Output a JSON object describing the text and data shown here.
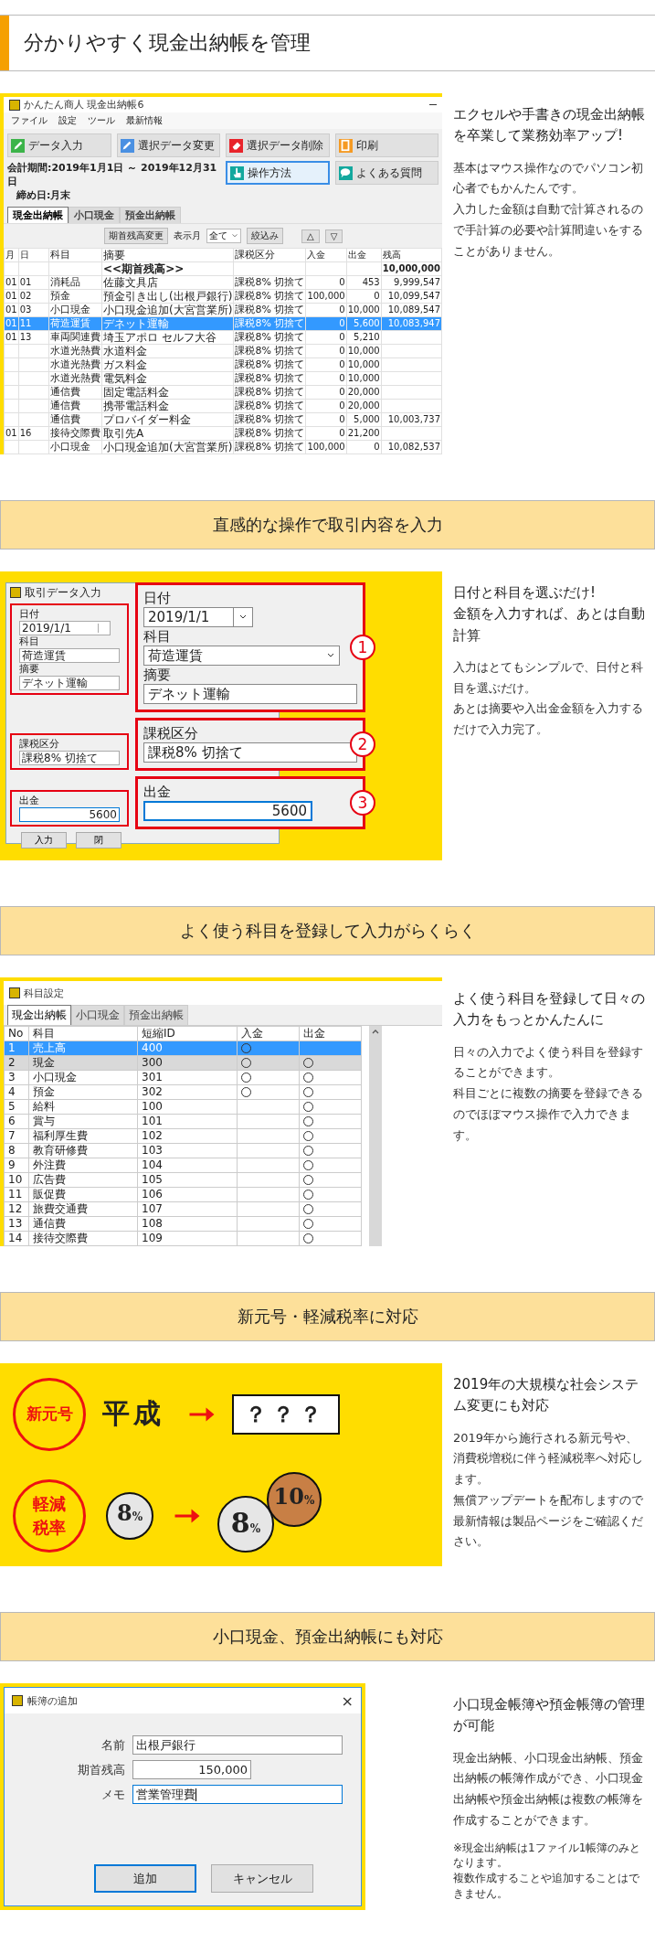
{
  "sections": [
    {
      "heading": "分かりやすく現金出納帳を管理",
      "lead": [
        "エクセルや手書きの現金出納帳を卒業して業務効率アップ!"
      ],
      "body": [
        "基本はマウス操作なのでパソコン初心者でもかんたんです。",
        "入力した金額は自動で計算されるので手計算の必要や計算間違いをすることがありません。"
      ],
      "visual": {
        "kind": "ledger",
        "window_title": "かんたん商人 現金出納帳6",
        "menu": [
          "ファイル",
          "設定",
          "ツール",
          "最新情報"
        ],
        "buttons": [
          {
            "label": "データ入力",
            "color": "#3cb44a",
            "focused": false
          },
          {
            "label": "選択データ変更",
            "color": "#4a90e2",
            "focused": false
          },
          {
            "label": "選択データ削除",
            "color": "#e8242b",
            "focused": false
          },
          {
            "label": "印刷",
            "color": "#f59a23",
            "focused": false
          },
          {
            "label": "操作方法",
            "color": "#13a89e",
            "focused": true
          },
          {
            "label": "よくある質問",
            "color": "#13a89e",
            "focused": false
          }
        ],
        "period": "会計期間:2019年1月1日 ～ 2019年12月31日",
        "closing": "締め日:月末",
        "tabs": [
          {
            "label": "現金出納帳",
            "selected": true
          },
          {
            "label": "小口現金",
            "selected": false
          },
          {
            "label": "預金出納帳",
            "selected": false
          }
        ],
        "toolbar": {
          "reset_button": "期首残高変更",
          "month_label": "表示月",
          "month_value": "全て",
          "filter_button": "絞込み",
          "up": "△",
          "down": "▽"
        },
        "columns": [
          "月",
          "日",
          "科目",
          "摘要",
          "課税区分",
          "入金",
          "出金",
          "残高"
        ],
        "rows": [
          {
            "kind": "opening",
            "selected": false,
            "cells": [
              null,
              null,
              null,
              "<<期首残高>>",
              null,
              null,
              null,
              "10,000,000"
            ]
          },
          {
            "kind": "entry",
            "selected": false,
            "cells": [
              "01",
              "01",
              "消耗品",
              "佐藤文具店",
              "課税8% 切捨て",
              "0",
              "453",
              "9,999,547"
            ]
          },
          {
            "kind": "entry",
            "selected": false,
            "cells": [
              "01",
              "02",
              "預金",
              "預金引き出し(出根戸銀行)",
              "課税8% 切捨て",
              "100,000",
              "0",
              "10,099,547"
            ]
          },
          {
            "kind": "entry",
            "selected": false,
            "cells": [
              "01",
              "03",
              "小口現金",
              "小口現金追加(大宮営業所)",
              "課税8% 切捨て",
              "0",
              "10,000",
              "10,089,547"
            ]
          },
          {
            "kind": "entry",
            "selected": true,
            "cells": [
              "01",
              "11",
              "荷造運賃",
              "デネット運輸",
              "課税8% 切捨て",
              "0",
              "5,600",
              "10,083,947"
            ]
          },
          {
            "kind": "entry",
            "selected": false,
            "cells": [
              "01",
              "13",
              "車両関連費",
              "埼玉アポロ セルフ大谷",
              "課税8% 切捨て",
              "0",
              "5,210",
              null
            ]
          },
          {
            "kind": "entry",
            "selected": false,
            "cells": [
              null,
              null,
              "水道光熱費",
              "水道料金",
              "課税8% 切捨て",
              "0",
              "10,000",
              null
            ]
          },
          {
            "kind": "entry",
            "selected": false,
            "cells": [
              null,
              null,
              "水道光熱費",
              "ガス料金",
              "課税8% 切捨て",
              "0",
              "10,000",
              null
            ]
          },
          {
            "kind": "entry",
            "selected": false,
            "cells": [
              null,
              null,
              "水道光熱費",
              "電気料金",
              "課税8% 切捨て",
              "0",
              "10,000",
              null
            ]
          },
          {
            "kind": "entry",
            "selected": false,
            "cells": [
              null,
              null,
              "通信費",
              "固定電話料金",
              "課税8% 切捨て",
              "0",
              "20,000",
              null
            ]
          },
          {
            "kind": "entry",
            "selected": false,
            "cells": [
              null,
              null,
              "通信費",
              "携帯電話料金",
              "課税8% 切捨て",
              "0",
              "20,000",
              null
            ]
          },
          {
            "kind": "entry",
            "selected": false,
            "cells": [
              null,
              null,
              "通信費",
              "プロバイダー料金",
              "課税8% 切捨て",
              "0",
              "5,000",
              "10,003,737"
            ]
          },
          {
            "kind": "entry",
            "selected": false,
            "cells": [
              "01",
              "16",
              "接待交際費",
              "取引先A",
              "課税8% 切捨て",
              "0",
              "21,200",
              null
            ]
          },
          {
            "kind": "entry",
            "selected": false,
            "cells": [
              null,
              null,
              "小口現金",
              "小口現金追加(大宮営業所)",
              "課税8% 切捨て",
              "100,000",
              "0",
              "10,082,537"
            ]
          }
        ]
      }
    },
    {
      "heading": "直感的な操作で取引内容を入力",
      "lead": [
        "日付と科目を選ぶだけ!",
        "金額を入力すれば、あとは自動計算"
      ],
      "body": [
        "入力はとてもシンプルで、日付と科目を選ぶだけ。",
        "あとは摘要や入出金金額を入力するだけで入力完了。"
      ],
      "visual": {
        "kind": "entry_form",
        "dialog_title": "取引データ入力",
        "form_groups": [
          {
            "fields": [
              {
                "label": "日付",
                "value": "2019/1/1",
                "kind": "date"
              },
              {
                "label": "科目",
                "value": "荷造運賃",
                "kind": "text"
              },
              {
                "label": "摘要",
                "value": "デネット運輸",
                "kind": "text"
              }
            ]
          },
          {
            "fields": [
              {
                "label": "課税区分",
                "value": "課税8% 切捨て",
                "kind": "text"
              }
            ]
          },
          {
            "fields": [
              {
                "label": "出金",
                "value": "5600",
                "kind": "amount"
              }
            ]
          }
        ],
        "buttons": [
          "入力",
          "閉"
        ],
        "callouts": [
          {
            "number": "1",
            "fields": [
              {
                "label": "日付",
                "value": "2019/1/1",
                "kind": "date"
              },
              {
                "label": "科目",
                "value": "荷造運賃",
                "kind": "select"
              },
              {
                "label": "摘要",
                "value": "デネット運輸",
                "kind": "text"
              }
            ]
          },
          {
            "number": "2",
            "fields": [
              {
                "label": "課税区分",
                "value": "課税8% 切捨て",
                "kind": "text"
              }
            ]
          },
          {
            "number": "3",
            "fields": [
              {
                "label": "出金",
                "value": "5600",
                "kind": "amount"
              }
            ]
          }
        ]
      }
    },
    {
      "heading": "よく使う科目を登録して入力がらくらく",
      "lead": [
        "よく使う科目を登録して日々の入力をもっとかんたんに"
      ],
      "body": [
        "日々の入力でよく使う科目を登録することができます。",
        "科目ごとに複数の摘要を登録できるのでほぼマウス操作で入力できます。"
      ],
      "visual": {
        "kind": "accounts",
        "window_title": "科目設定",
        "tabs": [
          {
            "label": "現金出納帳",
            "selected": true
          },
          {
            "label": "小口現金",
            "selected": false
          },
          {
            "label": "預金出納帳",
            "selected": false
          }
        ],
        "columns": [
          "No",
          "科目",
          "短縮ID",
          "入金",
          "出金"
        ],
        "rows": [
          {
            "no": "1",
            "name": "売上高",
            "code": "400",
            "deposit": true,
            "withdrawal": false,
            "selected": true,
            "highlighted": false
          },
          {
            "no": "2",
            "name": "現金",
            "code": "300",
            "deposit": true,
            "withdrawal": true,
            "selected": false,
            "highlighted": true
          },
          {
            "no": "3",
            "name": "小口現金",
            "code": "301",
            "deposit": true,
            "withdrawal": true,
            "selected": false,
            "highlighted": false
          },
          {
            "no": "4",
            "name": "預金",
            "code": "302",
            "deposit": true,
            "withdrawal": true,
            "selected": false,
            "highlighted": false
          },
          {
            "no": "5",
            "name": "給料",
            "code": "100",
            "deposit": false,
            "withdrawal": true,
            "selected": false,
            "highlighted": false
          },
          {
            "no": "6",
            "name": "賞与",
            "code": "101",
            "deposit": false,
            "withdrawal": true,
            "selected": false,
            "highlighted": false
          },
          {
            "no": "7",
            "name": "福利厚生費",
            "code": "102",
            "deposit": false,
            "withdrawal": true,
            "selected": false,
            "highlighted": false
          },
          {
            "no": "8",
            "name": "教育研修費",
            "code": "103",
            "deposit": false,
            "withdrawal": true,
            "selected": false,
            "highlighted": false
          },
          {
            "no": "9",
            "name": "外注費",
            "code": "104",
            "deposit": false,
            "withdrawal": true,
            "selected": false,
            "highlighted": false
          },
          {
            "no": "10",
            "name": "広告費",
            "code": "105",
            "deposit": false,
            "withdrawal": true,
            "selected": false,
            "highlighted": false
          },
          {
            "no": "11",
            "name": "販促費",
            "code": "106",
            "deposit": false,
            "withdrawal": true,
            "selected": false,
            "highlighted": false
          },
          {
            "no": "12",
            "name": "旅費交通費",
            "code": "107",
            "deposit": false,
            "withdrawal": true,
            "selected": false,
            "highlighted": false
          },
          {
            "no": "13",
            "name": "通信費",
            "code": "108",
            "deposit": false,
            "withdrawal": true,
            "selected": false,
            "highlighted": false
          },
          {
            "no": "14",
            "name": "接待交際費",
            "code": "109",
            "deposit": false,
            "withdrawal": true,
            "selected": false,
            "highlighted": false
          }
        ]
      }
    },
    {
      "heading": "新元号・軽減税率に対応",
      "lead": [
        "2019年の大規模な社会システム変更にも対応"
      ],
      "body": [
        "2019年から施行される新元号や、消費税増税に伴う軽減税率へ対応します。",
        "無償アップデートを配布しますので最新情報は製品ページをご確認ください。"
      ],
      "visual": {
        "kind": "era_tax",
        "era": {
          "badge": "新元号",
          "old": "平成",
          "new": "？？？"
        },
        "tax": {
          "badge": "軽減税率",
          "before": {
            "number": "8",
            "unit": "%",
            "color": "#e6e6e6"
          },
          "after": [
            {
              "number": "8",
              "unit": "%",
              "color": "#e6e6e6"
            },
            {
              "number": "10",
              "unit": "%",
              "color": "#c87f45"
            }
          ]
        }
      }
    },
    {
      "heading": "小口現金、預金出納帳にも対応",
      "lead": [
        "小口現金帳簿や預金帳簿の管理が可能"
      ],
      "body": [
        "現金出納帳、小口現金出納帳、預金出納帳の帳簿作成ができ、小口現金出納帳や預金出納帳は複数の帳簿を作成することができます。"
      ],
      "note": [
        "※現金出納帳は1ファイル1帳簿のみとなります。",
        "複数作成することや追加することはできません。"
      ],
      "visual": {
        "kind": "book_dialog",
        "window_title": "帳簿の追加",
        "close": "×",
        "fields": [
          {
            "label": "名前",
            "value": "出根戸銀行",
            "kind": "text",
            "focused": false
          },
          {
            "label": "期首残高",
            "value": "150,000",
            "kind": "amount",
            "focused": false
          },
          {
            "label": "メモ",
            "value": "営業管理費",
            "kind": "text",
            "focused": true
          }
        ],
        "buttons": [
          {
            "label": "追加",
            "default": true
          },
          {
            "label": "キャンセル",
            "default": false
          }
        ]
      }
    }
  ]
}
